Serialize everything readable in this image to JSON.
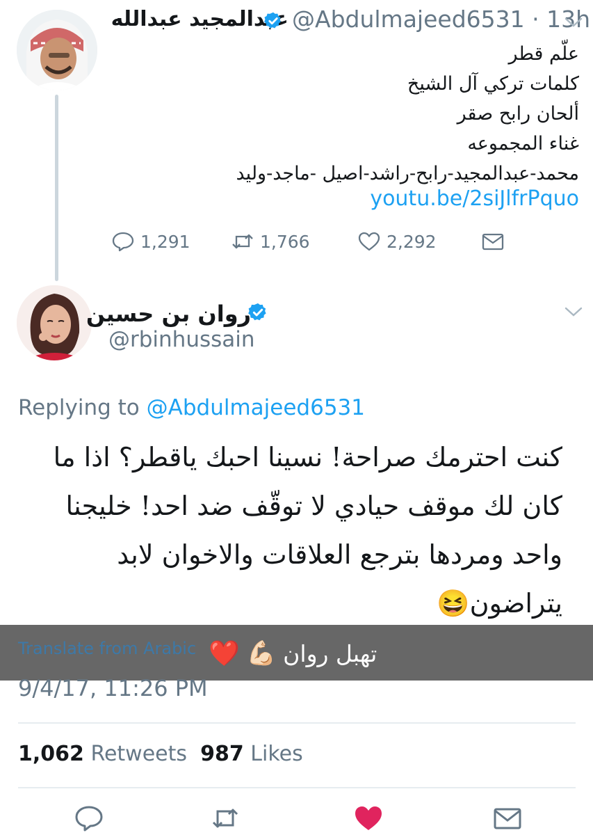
{
  "tweet1": {
    "author_name": "عبدالمجيد عبدالله",
    "handle_time": "@Abdulmajeed6531 · 13h",
    "lines": [
      "علّم قطر",
      "كلمات تركي آل الشيخ",
      "ألحان رابح صقر",
      "غناء المجموعه",
      "محمد-عبدالمجيد-رابح-راشد-اصيل -ماجد-وليد"
    ],
    "link": "youtu.be/2siJlfrPquo",
    "replies": "1,291",
    "retweets": "1,766",
    "likes": "2,292"
  },
  "tweet2": {
    "author_name": "روان بن حسين",
    "handle": "@rbinhussain",
    "replying_prefix": "Replying to",
    "replying_handle": "@Abdulmajeed6531",
    "lines": [
      "كنت احترمك صراحة! نسينا احبك ياقطر؟ اذا ما",
      "كان لك موقف حيادي لا توقّف ضد احد! خليجنا",
      "واحد ومردها بترجع العلاقات والاخوان لابد",
      "يتراضون😆"
    ],
    "translate": "Translate from Arabic",
    "timestamp": "9/4/17, 11:26 PM",
    "retweet_count": "1,062",
    "retweet_label": "Retweets",
    "like_count": "987",
    "like_label": "Likes"
  },
  "overlay": {
    "caption": "تهبل روان",
    "emoji_heart": "❤️",
    "emoji_muscle": "💪🏻"
  },
  "colors": {
    "accent": "#1da1f2",
    "muted": "#657786",
    "like_active": "#e0245e",
    "divider": "#e6ecf0"
  },
  "icons": [
    "verified-badge-icon",
    "chevron-down-icon",
    "reply-icon",
    "retweet-icon",
    "heart-icon",
    "direct-message-icon"
  ]
}
